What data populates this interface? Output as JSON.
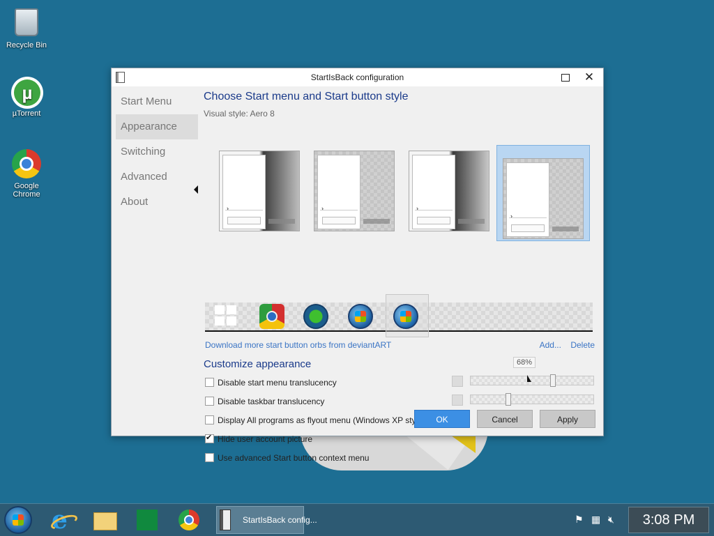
{
  "desktop": {
    "icons": [
      {
        "label": "Recycle Bin"
      },
      {
        "label": "µTorrent"
      },
      {
        "label": "Google Chrome"
      }
    ]
  },
  "window": {
    "title": "StartIsBack configuration",
    "nav": [
      "Start Menu",
      "Appearance",
      "Switching",
      "Advanced",
      "About"
    ],
    "active_nav": "Appearance",
    "heading": "Choose Start menu and Start button style",
    "visual_style_label": "Visual style:",
    "visual_style_value": "Aero 8",
    "download_link": "Download more start button orbs from deviantART",
    "add_link": "Add...",
    "delete_link": "Delete",
    "customize_heading": "Customize appearance",
    "options": [
      {
        "label": "Disable start menu translucency",
        "checked": false
      },
      {
        "label": "Disable taskbar translucency",
        "checked": false
      },
      {
        "label": "Display All programs as flyout menu (Windows XP style)",
        "checked": false
      },
      {
        "label": "Hide user account picture",
        "checked": true
      },
      {
        "label": "Use advanced Start button context menu",
        "checked": false
      }
    ],
    "slider_tooltip": "68%",
    "slider_values": [
      0.68,
      0.3
    ],
    "buttons": {
      "ok": "OK",
      "cancel": "Cancel",
      "apply": "Apply"
    }
  },
  "taskbar": {
    "running_app_label": "StartIsBack config...",
    "clock": "3:08 PM"
  },
  "colors": {
    "desktop": "#1d6e93",
    "accent": "#3c8fe4",
    "heading": "#1a3a8a",
    "link": "#3a74c4"
  }
}
